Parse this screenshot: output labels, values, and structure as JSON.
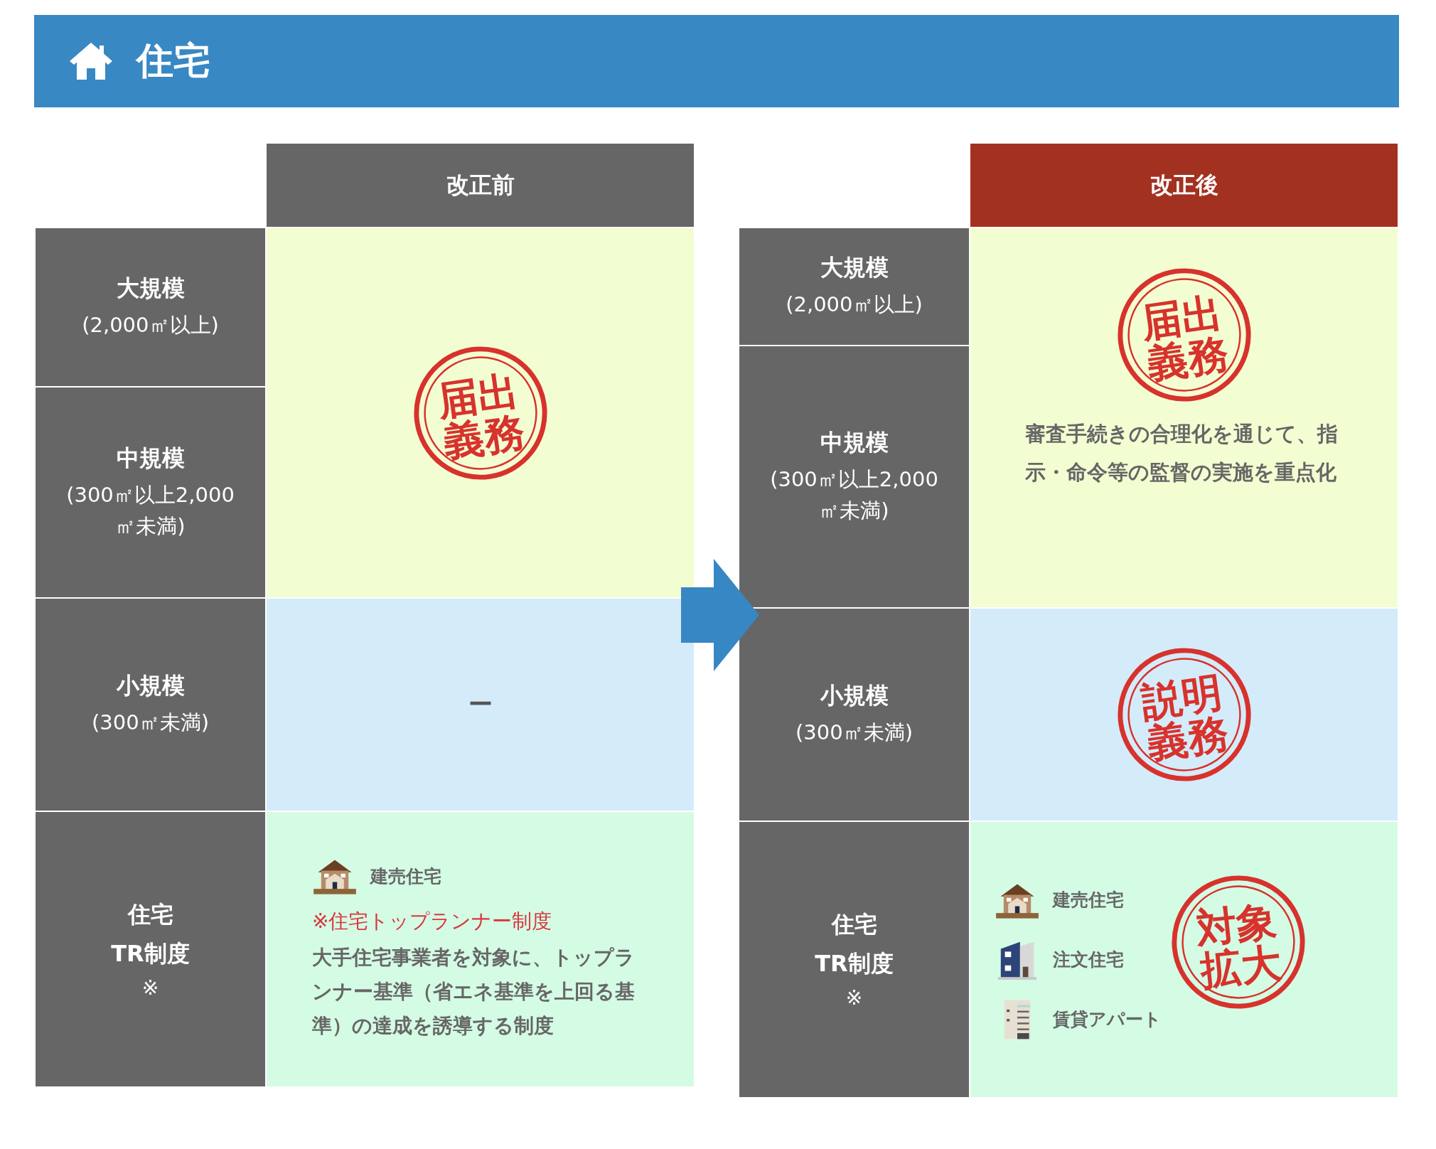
{
  "header": {
    "title": "住宅"
  },
  "panels": [
    {
      "heading": "改正前",
      "kind": "before",
      "sections": [
        {
          "color": "#f3fdd2",
          "labels": [
            {
              "title": "大規模",
              "note": "(2,000㎡以上)"
            },
            {
              "title": "中規模",
              "note": "(300㎡以上2,000㎡未満)"
            }
          ],
          "content": {
            "kind": "stamp",
            "stamp": [
              "届出",
              "義務"
            ]
          }
        },
        {
          "color": "#d4ebfa",
          "labels": [
            {
              "title": "小規模",
              "note": "(300㎡未満)"
            }
          ],
          "content": {
            "kind": "dash",
            "text": "ー"
          }
        },
        {
          "color": "#d4fbe4",
          "labels": [
            {
              "title": "住宅",
              "note": "TR制度",
              "mark": "※"
            }
          ],
          "content": {
            "kind": "tr",
            "items": [
              {
                "kind": "house",
                "label": "建売住宅"
              }
            ],
            "note": "※住宅トップランナー制度",
            "text": "大手住宅事業者を対象に、トップランナー基準（省エネ基準を上回る基準）の達成を誘導する制度"
          }
        }
      ]
    },
    {
      "heading": "改正後",
      "kind": "after",
      "sections": [
        {
          "color": "#f3fdd2",
          "labels": [
            {
              "title": "大規模",
              "note": "(2,000㎡以上)"
            },
            {
              "title": "中規模",
              "note": "(300㎡以上2,000㎡未満)"
            }
          ],
          "content": {
            "kind": "stamp",
            "stamp": [
              "届出",
              "義務"
            ],
            "text": "審査手続きの合理化を通じて、指示・命令等の監督の実施を重点化"
          }
        },
        {
          "color": "#d4ebfa",
          "labels": [
            {
              "title": "小規模",
              "note": "(300㎡未満)"
            }
          ],
          "content": {
            "kind": "stamp",
            "stamp": [
              "説明",
              "義務"
            ]
          }
        },
        {
          "color": "#d4fbe4",
          "labels": [
            {
              "title": "住宅",
              "note": "TR制度",
              "mark": "※"
            }
          ],
          "content": {
            "kind": "tr",
            "items": [
              {
                "kind": "house",
                "label": "建売住宅"
              },
              {
                "kind": "modern",
                "label": "注文住宅"
              },
              {
                "kind": "apartment",
                "label": "賃貸アパート"
              }
            ],
            "stamp": [
              "対象",
              "拡大"
            ]
          }
        }
      ]
    }
  ]
}
